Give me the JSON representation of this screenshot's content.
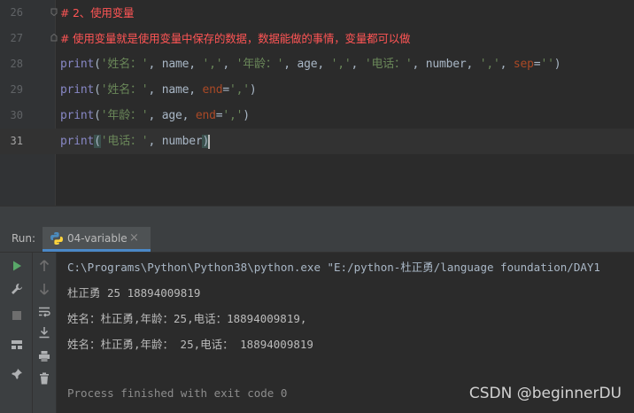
{
  "editor": {
    "lines": [
      {
        "number": "26",
        "segments": [
          {
            "t": "# 2、使用变量",
            "c": "cm"
          }
        ]
      },
      {
        "number": "27",
        "segments": [
          {
            "t": "# 使用变量就是使用变量中保存的数据，数据能做的事情，变量都可以做",
            "c": "cm"
          }
        ]
      },
      {
        "number": "28",
        "segments": [
          {
            "t": "print",
            "c": "fn"
          },
          {
            "t": "(",
            "c": ""
          },
          {
            "t": "'姓名：'",
            "c": "str"
          },
          {
            "t": ", name, ",
            "c": ""
          },
          {
            "t": "','",
            "c": "str"
          },
          {
            "t": ", ",
            "c": ""
          },
          {
            "t": "'年龄：'",
            "c": "str"
          },
          {
            "t": ", age, ",
            "c": ""
          },
          {
            "t": "','",
            "c": "str"
          },
          {
            "t": ", ",
            "c": ""
          },
          {
            "t": "'电话：'",
            "c": "str"
          },
          {
            "t": ", number, ",
            "c": ""
          },
          {
            "t": "','",
            "c": "str"
          },
          {
            "t": ", ",
            "c": ""
          },
          {
            "t": "sep",
            "c": "kw"
          },
          {
            "t": "=",
            "c": ""
          },
          {
            "t": "''",
            "c": "str"
          },
          {
            "t": ")",
            "c": ""
          }
        ]
      },
      {
        "number": "29",
        "segments": [
          {
            "t": "print",
            "c": "fn"
          },
          {
            "t": "(",
            "c": ""
          },
          {
            "t": "'姓名：'",
            "c": "str"
          },
          {
            "t": ", name, ",
            "c": ""
          },
          {
            "t": "end",
            "c": "kw"
          },
          {
            "t": "=",
            "c": ""
          },
          {
            "t": "','",
            "c": "str"
          },
          {
            "t": ")",
            "c": ""
          }
        ]
      },
      {
        "number": "30",
        "segments": [
          {
            "t": "print",
            "c": "fn"
          },
          {
            "t": "(",
            "c": ""
          },
          {
            "t": "'年龄：'",
            "c": "str"
          },
          {
            "t": ", age, ",
            "c": ""
          },
          {
            "t": "end",
            "c": "kw"
          },
          {
            "t": "=",
            "c": ""
          },
          {
            "t": "','",
            "c": "str"
          },
          {
            "t": ")",
            "c": ""
          }
        ]
      },
      {
        "number": "31",
        "current": true,
        "segments": [
          {
            "t": "print",
            "c": "fn"
          },
          {
            "t": "(",
            "c": "hl"
          },
          {
            "t": "'电话：'",
            "c": "str"
          },
          {
            "t": ", number",
            "c": ""
          },
          {
            "t": ")",
            "c": "hl"
          }
        ]
      }
    ]
  },
  "run_panel": {
    "label": "Run:",
    "tab_label": "04-variable",
    "close_glyph": "×"
  },
  "console": {
    "command": "C:\\Programs\\Python\\Python38\\python.exe \"E:/python-杜正勇/language foundation/DAY1",
    "output": [
      "杜正勇 25 18894009819",
      "姓名：杜正勇,年龄：25,电话：18894009819,",
      "姓名：杜正勇,年龄： 25,电话： 18894009819"
    ],
    "exit_message": "Process finished with exit code 0"
  },
  "watermark": "CSDN @beginnerDU",
  "colors": {
    "comment": "#ff5555",
    "builtin": "#8888c6",
    "string": "#6a8759",
    "keyword_arg": "#aa4926",
    "run_green": "#59a869"
  }
}
